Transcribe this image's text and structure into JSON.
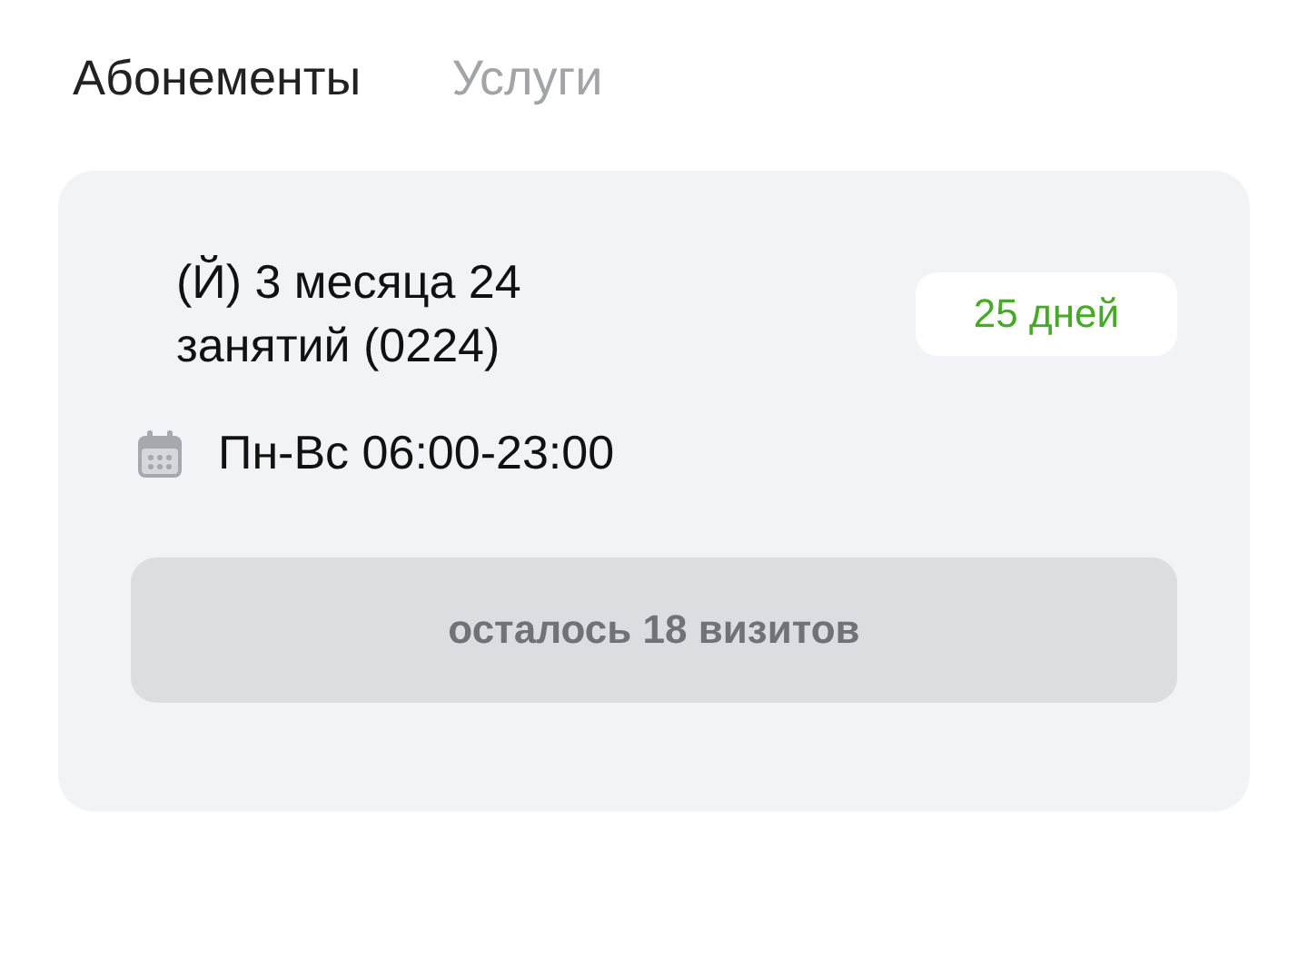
{
  "tabs": [
    {
      "label": "Абонементы",
      "selected": true
    },
    {
      "label": "Услуги",
      "selected": false
    }
  ],
  "subscription": {
    "title": "(Й) 3 месяца 24 занятий (0224)",
    "badge": "25 дней",
    "schedule": "Пн-Вс 06:00-23:00",
    "visits_button": {
      "label": "осталось 18 визитов",
      "disabled": true
    }
  }
}
